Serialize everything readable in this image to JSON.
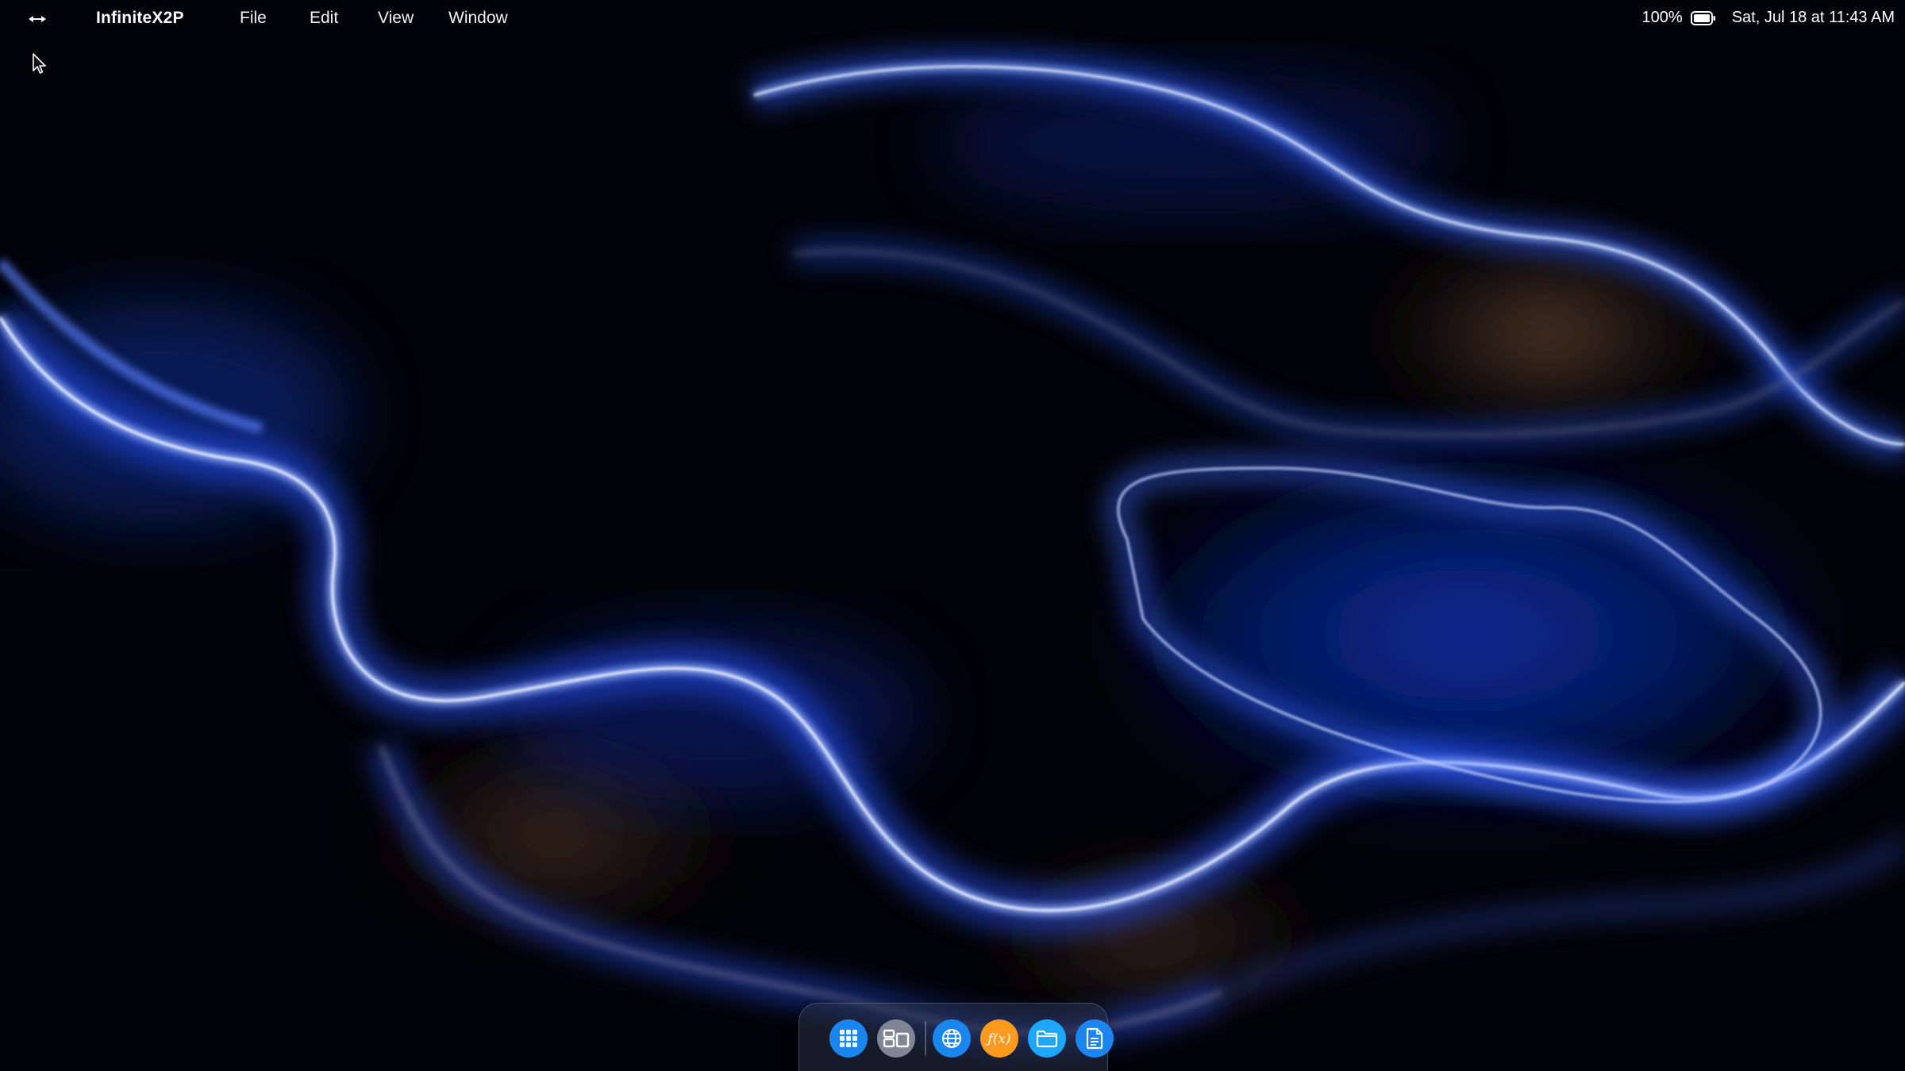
{
  "menubar": {
    "app_menu_icon": "double-arrow-icon",
    "app_name": "InfiniteX2P",
    "menus": [
      "File",
      "Edit",
      "View",
      "Window"
    ],
    "battery": {
      "percent_label": "100%",
      "level": 1.0,
      "icon": "battery-icon"
    },
    "datetime": "Sat, Jul 18 at 11:43 AM"
  },
  "dock": {
    "items": [
      {
        "name": "app-launcher",
        "icon": "grid-icon",
        "color": "#1e90ff"
      },
      {
        "name": "window-switcher",
        "icon": "windows-layout-icon",
        "color": "#8e8e93"
      },
      {
        "name": "browser",
        "icon": "globe-icon",
        "color": "#1e90ff"
      },
      {
        "name": "calculator",
        "icon": "function-icon",
        "color": "#ff9a1f"
      },
      {
        "name": "files",
        "icon": "folder-icon",
        "color": "#1ea7ff"
      },
      {
        "name": "documents",
        "icon": "document-icon",
        "color": "#1e90ff"
      }
    ]
  },
  "colors": {
    "background": "#020308",
    "wave_blue": "#3a6bff",
    "wave_highlight": "#dfe8ff",
    "wave_copper": "#b8896a"
  }
}
